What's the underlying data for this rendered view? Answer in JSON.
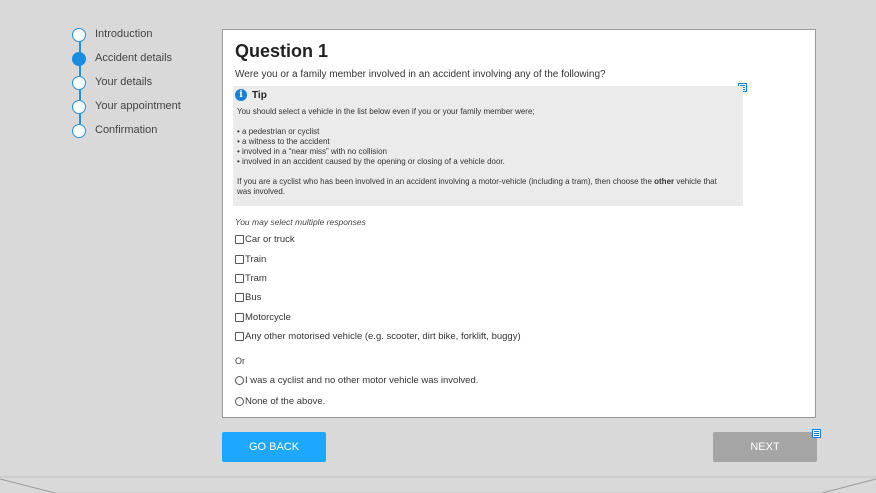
{
  "steps": [
    {
      "label": "Introduction",
      "active": false
    },
    {
      "label": "Accident details",
      "active": true
    },
    {
      "label": "Your details",
      "active": false
    },
    {
      "label": "Your appointment",
      "active": false
    },
    {
      "label": "Confirmation",
      "active": false
    }
  ],
  "question": {
    "title": "Question 1",
    "text": "Were you or a family member involved in an accident involving any of the following?"
  },
  "tip": {
    "icon_glyph": "i",
    "title": "Tip",
    "intro": "You should select a vehicle in the list below even if you or your family member were;",
    "bullets": [
      "• a pedestrian or cyclist",
      "• a witness to the accident",
      "• involved in a “near miss” with no collision",
      "• involved in an accident caused by the opening or closing of a vehicle door."
    ],
    "outro_before": "If you are a cyclist who has been involved in an accident involving a motor-vehicle (including a tram), then choose the ",
    "outro_bold": "other",
    "outro_after": " vehicle that was involved."
  },
  "instruction": "You may select multiple responses",
  "checkbox_options": [
    "Car or truck",
    "Train",
    "Tram",
    "Bus",
    "Motorcycle",
    "Any other motorised vehicle (e.g. scooter, dirt bike, forklift, buggy)"
  ],
  "or_label": "Or",
  "radio_options": [
    "I was a cyclist and no other motor vehicle was involved.",
    "None of the above."
  ],
  "buttons": {
    "back": "GO BACK",
    "next": "NEXT"
  },
  "colors": {
    "accent": "#1ea7ff",
    "step_line": "#2a8fd9",
    "next_disabled": "#a5a5a5",
    "tip_background": "#ebebeb"
  }
}
